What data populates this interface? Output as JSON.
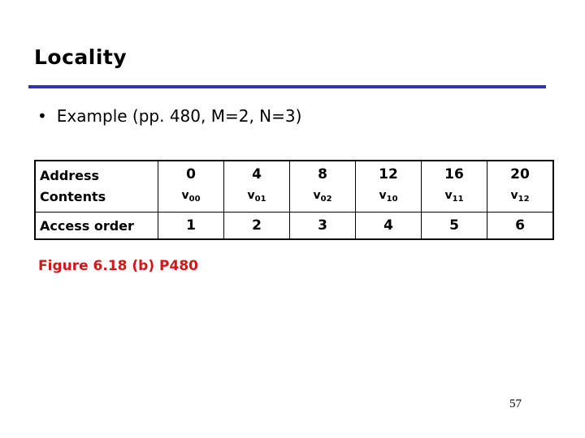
{
  "slide": {
    "title": "Locality",
    "bullet": "Example (pp. 480, M=2, N=3)",
    "bullet_marker": "•",
    "figure_caption": "Figure 6.18 (b)  P480",
    "page_number": "57",
    "accent_color": "#3333aa",
    "caption_color": "#d01818"
  },
  "table": {
    "row_labels": {
      "address": "Address",
      "contents": "Contents",
      "access_order": "Access order"
    },
    "columns": [
      {
        "address": "0",
        "contents_base": "v",
        "contents_sub": "00",
        "access_order": "1"
      },
      {
        "address": "4",
        "contents_base": "v",
        "contents_sub": "01",
        "access_order": "2"
      },
      {
        "address": "8",
        "contents_base": "v",
        "contents_sub": "02",
        "access_order": "3"
      },
      {
        "address": "12",
        "contents_base": "v",
        "contents_sub": "10",
        "access_order": "4"
      },
      {
        "address": "16",
        "contents_base": "v",
        "contents_sub": "11",
        "access_order": "5"
      },
      {
        "address": "20",
        "contents_base": "v",
        "contents_sub": "12",
        "access_order": "6"
      }
    ]
  }
}
